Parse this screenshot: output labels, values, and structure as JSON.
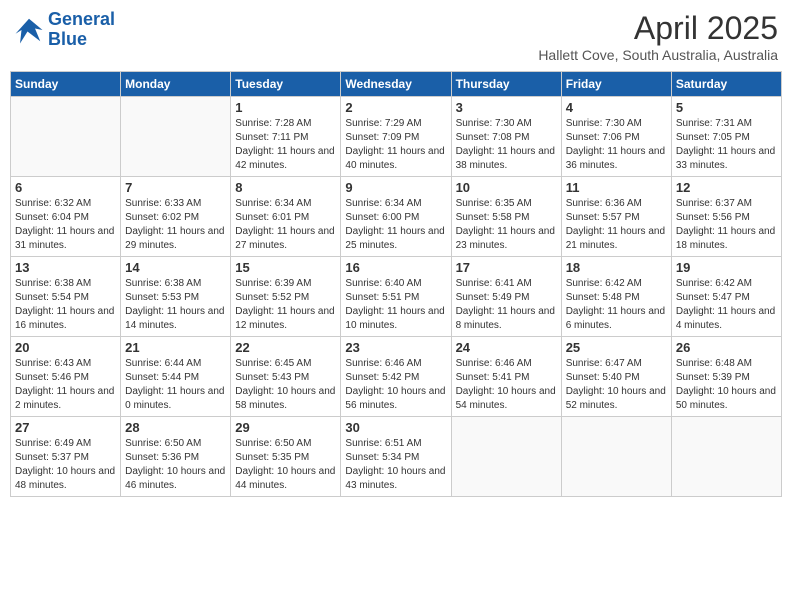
{
  "header": {
    "logo_line1": "General",
    "logo_line2": "Blue",
    "month": "April 2025",
    "location": "Hallett Cove, South Australia, Australia"
  },
  "weekdays": [
    "Sunday",
    "Monday",
    "Tuesday",
    "Wednesday",
    "Thursday",
    "Friday",
    "Saturday"
  ],
  "weeks": [
    [
      {
        "day": "",
        "sunrise": "",
        "sunset": "",
        "daylight": ""
      },
      {
        "day": "",
        "sunrise": "",
        "sunset": "",
        "daylight": ""
      },
      {
        "day": "1",
        "sunrise": "Sunrise: 7:28 AM",
        "sunset": "Sunset: 7:11 PM",
        "daylight": "Daylight: 11 hours and 42 minutes."
      },
      {
        "day": "2",
        "sunrise": "Sunrise: 7:29 AM",
        "sunset": "Sunset: 7:09 PM",
        "daylight": "Daylight: 11 hours and 40 minutes."
      },
      {
        "day": "3",
        "sunrise": "Sunrise: 7:30 AM",
        "sunset": "Sunset: 7:08 PM",
        "daylight": "Daylight: 11 hours and 38 minutes."
      },
      {
        "day": "4",
        "sunrise": "Sunrise: 7:30 AM",
        "sunset": "Sunset: 7:06 PM",
        "daylight": "Daylight: 11 hours and 36 minutes."
      },
      {
        "day": "5",
        "sunrise": "Sunrise: 7:31 AM",
        "sunset": "Sunset: 7:05 PM",
        "daylight": "Daylight: 11 hours and 33 minutes."
      }
    ],
    [
      {
        "day": "6",
        "sunrise": "Sunrise: 6:32 AM",
        "sunset": "Sunset: 6:04 PM",
        "daylight": "Daylight: 11 hours and 31 minutes."
      },
      {
        "day": "7",
        "sunrise": "Sunrise: 6:33 AM",
        "sunset": "Sunset: 6:02 PM",
        "daylight": "Daylight: 11 hours and 29 minutes."
      },
      {
        "day": "8",
        "sunrise": "Sunrise: 6:34 AM",
        "sunset": "Sunset: 6:01 PM",
        "daylight": "Daylight: 11 hours and 27 minutes."
      },
      {
        "day": "9",
        "sunrise": "Sunrise: 6:34 AM",
        "sunset": "Sunset: 6:00 PM",
        "daylight": "Daylight: 11 hours and 25 minutes."
      },
      {
        "day": "10",
        "sunrise": "Sunrise: 6:35 AM",
        "sunset": "Sunset: 5:58 PM",
        "daylight": "Daylight: 11 hours and 23 minutes."
      },
      {
        "day": "11",
        "sunrise": "Sunrise: 6:36 AM",
        "sunset": "Sunset: 5:57 PM",
        "daylight": "Daylight: 11 hours and 21 minutes."
      },
      {
        "day": "12",
        "sunrise": "Sunrise: 6:37 AM",
        "sunset": "Sunset: 5:56 PM",
        "daylight": "Daylight: 11 hours and 18 minutes."
      }
    ],
    [
      {
        "day": "13",
        "sunrise": "Sunrise: 6:38 AM",
        "sunset": "Sunset: 5:54 PM",
        "daylight": "Daylight: 11 hours and 16 minutes."
      },
      {
        "day": "14",
        "sunrise": "Sunrise: 6:38 AM",
        "sunset": "Sunset: 5:53 PM",
        "daylight": "Daylight: 11 hours and 14 minutes."
      },
      {
        "day": "15",
        "sunrise": "Sunrise: 6:39 AM",
        "sunset": "Sunset: 5:52 PM",
        "daylight": "Daylight: 11 hours and 12 minutes."
      },
      {
        "day": "16",
        "sunrise": "Sunrise: 6:40 AM",
        "sunset": "Sunset: 5:51 PM",
        "daylight": "Daylight: 11 hours and 10 minutes."
      },
      {
        "day": "17",
        "sunrise": "Sunrise: 6:41 AM",
        "sunset": "Sunset: 5:49 PM",
        "daylight": "Daylight: 11 hours and 8 minutes."
      },
      {
        "day": "18",
        "sunrise": "Sunrise: 6:42 AM",
        "sunset": "Sunset: 5:48 PM",
        "daylight": "Daylight: 11 hours and 6 minutes."
      },
      {
        "day": "19",
        "sunrise": "Sunrise: 6:42 AM",
        "sunset": "Sunset: 5:47 PM",
        "daylight": "Daylight: 11 hours and 4 minutes."
      }
    ],
    [
      {
        "day": "20",
        "sunrise": "Sunrise: 6:43 AM",
        "sunset": "Sunset: 5:46 PM",
        "daylight": "Daylight: 11 hours and 2 minutes."
      },
      {
        "day": "21",
        "sunrise": "Sunrise: 6:44 AM",
        "sunset": "Sunset: 5:44 PM",
        "daylight": "Daylight: 11 hours and 0 minutes."
      },
      {
        "day": "22",
        "sunrise": "Sunrise: 6:45 AM",
        "sunset": "Sunset: 5:43 PM",
        "daylight": "Daylight: 10 hours and 58 minutes."
      },
      {
        "day": "23",
        "sunrise": "Sunrise: 6:46 AM",
        "sunset": "Sunset: 5:42 PM",
        "daylight": "Daylight: 10 hours and 56 minutes."
      },
      {
        "day": "24",
        "sunrise": "Sunrise: 6:46 AM",
        "sunset": "Sunset: 5:41 PM",
        "daylight": "Daylight: 10 hours and 54 minutes."
      },
      {
        "day": "25",
        "sunrise": "Sunrise: 6:47 AM",
        "sunset": "Sunset: 5:40 PM",
        "daylight": "Daylight: 10 hours and 52 minutes."
      },
      {
        "day": "26",
        "sunrise": "Sunrise: 6:48 AM",
        "sunset": "Sunset: 5:39 PM",
        "daylight": "Daylight: 10 hours and 50 minutes."
      }
    ],
    [
      {
        "day": "27",
        "sunrise": "Sunrise: 6:49 AM",
        "sunset": "Sunset: 5:37 PM",
        "daylight": "Daylight: 10 hours and 48 minutes."
      },
      {
        "day": "28",
        "sunrise": "Sunrise: 6:50 AM",
        "sunset": "Sunset: 5:36 PM",
        "daylight": "Daylight: 10 hours and 46 minutes."
      },
      {
        "day": "29",
        "sunrise": "Sunrise: 6:50 AM",
        "sunset": "Sunset: 5:35 PM",
        "daylight": "Daylight: 10 hours and 44 minutes."
      },
      {
        "day": "30",
        "sunrise": "Sunrise: 6:51 AM",
        "sunset": "Sunset: 5:34 PM",
        "daylight": "Daylight: 10 hours and 43 minutes."
      },
      {
        "day": "",
        "sunrise": "",
        "sunset": "",
        "daylight": ""
      },
      {
        "day": "",
        "sunrise": "",
        "sunset": "",
        "daylight": ""
      },
      {
        "day": "",
        "sunrise": "",
        "sunset": "",
        "daylight": ""
      }
    ]
  ]
}
